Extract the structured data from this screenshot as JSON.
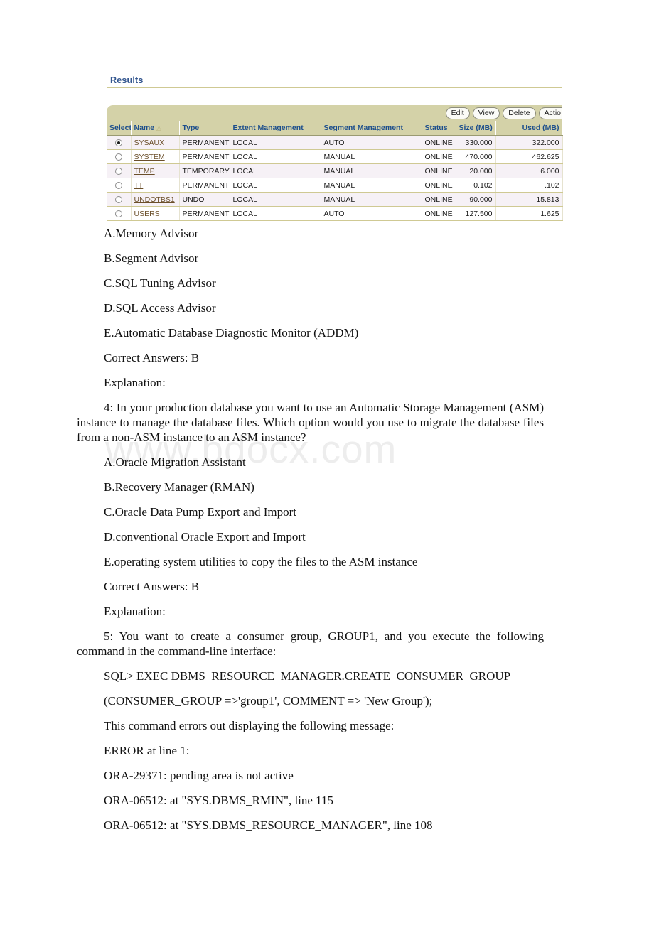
{
  "watermark": "www.bdocx.com",
  "em": {
    "heading": "Results",
    "toolbar": {
      "edit_label": "Edit",
      "view_label": "View",
      "delete_label": "Delete",
      "actions_label": "Actio"
    },
    "columns": [
      {
        "key": "select",
        "label": "Select",
        "align": "center",
        "sorted": false
      },
      {
        "key": "name",
        "label": "Name",
        "align": "left",
        "sorted": true,
        "sort_arrow": "△"
      },
      {
        "key": "type",
        "label": "Type",
        "align": "left",
        "sorted": false
      },
      {
        "key": "extent_management",
        "label": "Extent Management",
        "align": "left",
        "sorted": false
      },
      {
        "key": "segment_management",
        "label": "Segment Management",
        "align": "left",
        "sorted": false
      },
      {
        "key": "status",
        "label": "Status",
        "align": "left",
        "sorted": false
      },
      {
        "key": "size_mb",
        "label": "Size (MB)",
        "align": "right",
        "sorted": false
      },
      {
        "key": "used_mb",
        "label": "Used (MB)",
        "align": "right",
        "sorted": false
      }
    ],
    "rows": [
      {
        "selected": true,
        "name": "SYSAUX",
        "type": "PERMANENT",
        "extent_management": "LOCAL",
        "segment_management": "AUTO",
        "status": "ONLINE",
        "size_mb": "330.000",
        "used_mb": "322.000"
      },
      {
        "selected": false,
        "name": "SYSTEM",
        "type": "PERMANENT",
        "extent_management": "LOCAL",
        "segment_management": "MANUAL",
        "status": "ONLINE",
        "size_mb": "470.000",
        "used_mb": "462.625"
      },
      {
        "selected": false,
        "name": "TEMP",
        "type": "TEMPORARY",
        "extent_management": "LOCAL",
        "segment_management": "MANUAL",
        "status": "ONLINE",
        "size_mb": "20.000",
        "used_mb": "6.000"
      },
      {
        "selected": false,
        "name": "TT",
        "type": "PERMANENT",
        "extent_management": "LOCAL",
        "segment_management": "MANUAL",
        "status": "ONLINE",
        "size_mb": "0.102",
        "used_mb": ".102"
      },
      {
        "selected": false,
        "name": "UNDOTBS1",
        "type": "UNDO",
        "extent_management": "LOCAL",
        "segment_management": "MANUAL",
        "status": "ONLINE",
        "size_mb": "90.000",
        "used_mb": "15.813"
      },
      {
        "selected": false,
        "name": "USERS",
        "type": "PERMANENT",
        "extent_management": "LOCAL",
        "segment_management": "AUTO",
        "status": "ONLINE",
        "size_mb": "127.500",
        "used_mb": "1.625"
      }
    ]
  },
  "document": {
    "q3_options": [
      "A.Memory Advisor",
      "B.Segment Advisor",
      "C.SQL Tuning Advisor",
      "D.SQL Access Advisor",
      "E.Automatic Database Diagnostic Monitor (ADDM)"
    ],
    "q3_answer": "Correct Answers: B",
    "q3_explanation": "Explanation:",
    "q4_stem": "4: In your production database you want to use an Automatic Storage Management (ASM) instance to manage the database files. Which option would you use to migrate the database files from a non-ASM instance to an ASM instance?",
    "q4_options": [
      "A.Oracle Migration Assistant",
      "B.Recovery Manager (RMAN)",
      "C.Oracle Data Pump Export and Import",
      "D.conventional Oracle Export and Import",
      "E.operating system utilities to copy the files to the ASM instance"
    ],
    "q4_answer": "Correct Answers: B",
    "q4_explanation": "Explanation:",
    "q5_stem": "5: You want to create a consumer group, GROUP1, and you execute the following command in the command-line interface:",
    "q5_lines": [
      "SQL> EXEC DBMS_RESOURCE_MANAGER.CREATE_CONSUMER_GROUP",
      "(CONSUMER_GROUP =>'group1', COMMENT => 'New Group');",
      "This command errors out displaying the following message:",
      "ERROR at line 1:",
      "ORA-29371: pending area is not active",
      "ORA-06512: at \"SYS.DBMS_RMIN\", line 115",
      "ORA-06512: at \"SYS.DBMS_RESOURCE_MANAGER\", line 108"
    ]
  }
}
